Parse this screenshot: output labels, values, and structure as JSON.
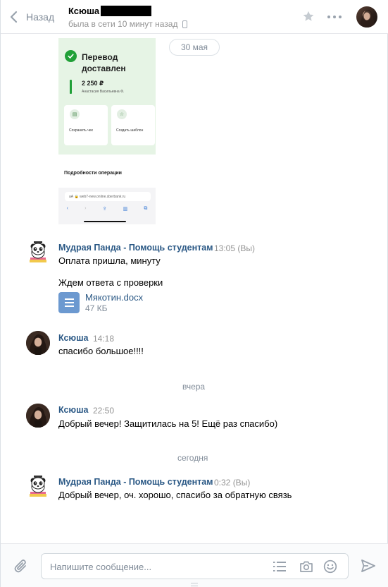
{
  "header": {
    "back_label": "Назад",
    "peer_name": "Ксюша",
    "peer_status": "была в сети 10 минут назад"
  },
  "history": {
    "date_pill": "30 мая"
  },
  "screenshot": {
    "title": "Перевод доставлен",
    "amount": "2 250 ₽",
    "recipient": "Анастасия Васильевна Ф.",
    "card1": "Сохранить чек",
    "card2": "Создать шаблон",
    "details": "Подробности операции",
    "url": "аА  🔒 web7-new.online.sberbank.ru"
  },
  "messages": [
    {
      "author": "Мудрая Панда - Помощь студентам",
      "time": "13:05 (Вы)",
      "lines": [
        "Оплата пришла, минуту",
        "Ждем ответа с проверки"
      ],
      "attachment": {
        "name": "Мякотин.docx",
        "size": "47 КБ"
      }
    },
    {
      "author": "Ксюша",
      "time": "14:18",
      "lines": [
        "спасибо большое!!!!"
      ]
    },
    {
      "divider": "вчера"
    },
    {
      "author": "Ксюша",
      "time": "22:50",
      "lines": [
        "Добрый вечер! Защитилась на 5! Ещё раз спасибо)"
      ]
    },
    {
      "divider": "сегодня"
    },
    {
      "author": "Мудрая Панда - Помощь студентам",
      "time": "0:32 (Вы)",
      "lines": [
        "Добрый вечер, оч. хорошо, спасибо за обратную связь"
      ]
    }
  ],
  "composer": {
    "placeholder": "Напишите сообщение..."
  },
  "icons": {
    "back": "chevron-left-icon",
    "star": "star-icon",
    "more": "more-dots-icon",
    "attach": "paperclip-icon",
    "templates": "list-icon",
    "camera": "camera-icon",
    "emoji": "smile-icon",
    "send": "send-icon",
    "document": "document-icon"
  },
  "colors": {
    "link": "#2a5885",
    "muted": "#818c99",
    "accent_green": "#21a038",
    "doc_blue": "#6c99d0"
  }
}
